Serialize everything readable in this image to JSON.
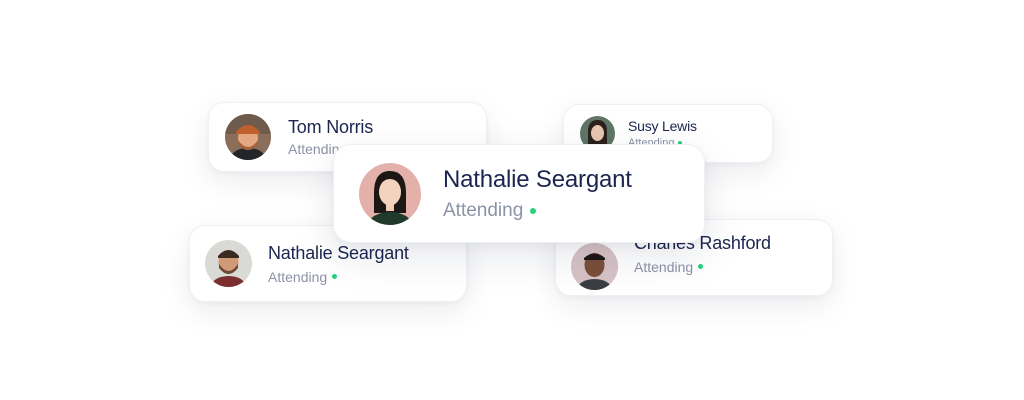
{
  "attendees": [
    {
      "id": "tom",
      "name": "Tom Norris",
      "status": "Attending",
      "avatar_icon": "person-avatar-beanie-beard"
    },
    {
      "id": "susy",
      "name": "Susy Lewis",
      "status": "Attending",
      "avatar_icon": "person-avatar-dark-hair"
    },
    {
      "id": "nathalie_main",
      "name": "Nathalie Seargant",
      "status": "Attending",
      "avatar_icon": "person-avatar-woman-black-hair"
    },
    {
      "id": "nathalie_2",
      "name": "Nathalie Seargant",
      "status": "Attending",
      "avatar_icon": "person-avatar-man-beard"
    },
    {
      "id": "charles",
      "name": "Charles Rashford",
      "status": "Attending",
      "avatar_icon": "person-avatar-man-dark"
    }
  ],
  "colors": {
    "name_text": "#1b2550",
    "status_text": "#8c93a8",
    "status_dot": "#27d17f",
    "card_background": "#ffffff"
  }
}
